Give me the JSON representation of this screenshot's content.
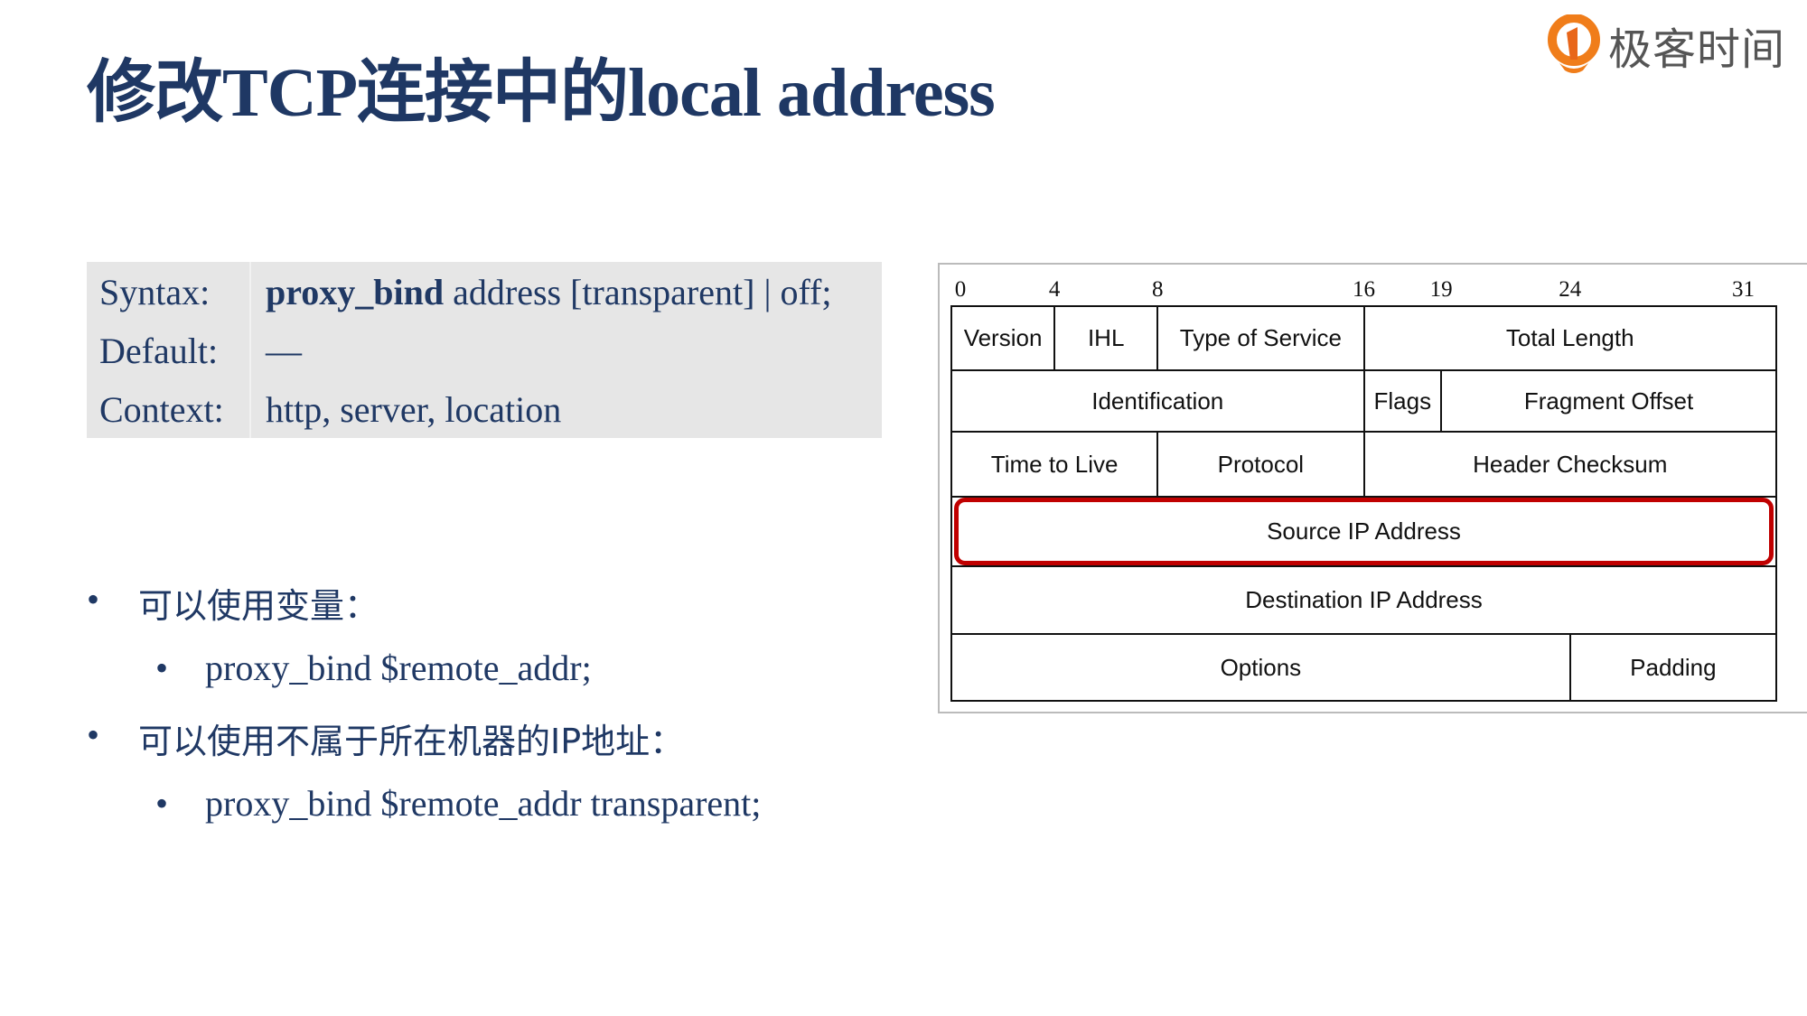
{
  "title": "修改TCP连接中的local address",
  "logo": {
    "text": "极客时间",
    "color": "#f07d1a"
  },
  "syntax_box": {
    "rows": [
      {
        "label": "Syntax:",
        "keyword": "proxy_bind",
        "value": " address [transparent] | off;"
      },
      {
        "label": "Default:",
        "keyword": "",
        "value": "—"
      },
      {
        "label": "Context:",
        "keyword": "",
        "value": "http, server, location"
      }
    ]
  },
  "bullets": [
    {
      "text": "可以使用变量：",
      "sub": "proxy_bind $remote_addr;"
    },
    {
      "text": "可以使用不属于所在机器的IP地址：",
      "sub": "proxy_bind $remote_addr transparent;"
    }
  ],
  "diagram": {
    "bit_labels": [
      "0",
      "4",
      "8",
      "16",
      "19",
      "24",
      "31"
    ],
    "fields": [
      {
        "name": "Version",
        "row": 0,
        "from": 0,
        "to": 4
      },
      {
        "name": "IHL",
        "row": 0,
        "from": 4,
        "to": 8
      },
      {
        "name": "Type of Service",
        "row": 0,
        "from": 8,
        "to": 16
      },
      {
        "name": "Total Length",
        "row": 0,
        "from": 16,
        "to": 32
      },
      {
        "name": "Identification",
        "row": 1,
        "from": 0,
        "to": 16
      },
      {
        "name": "Flags",
        "row": 1,
        "from": 16,
        "to": 19
      },
      {
        "name": "Fragment Offset",
        "row": 1,
        "from": 19,
        "to": 32
      },
      {
        "name": "Time to Live",
        "row": 2,
        "from": 0,
        "to": 8
      },
      {
        "name": "Protocol",
        "row": 2,
        "from": 8,
        "to": 16
      },
      {
        "name": "Header Checksum",
        "row": 2,
        "from": 16,
        "to": 32
      },
      {
        "name": "Source IP Address",
        "row": 3,
        "from": 0,
        "to": 32,
        "highlighted": true
      },
      {
        "name": "Destination IP Address",
        "row": 4,
        "from": 0,
        "to": 32
      },
      {
        "name": "Options",
        "row": 5,
        "from": 0,
        "to": 24
      },
      {
        "name": "Padding",
        "row": 5,
        "from": 24,
        "to": 32
      }
    ],
    "highlight_color": "#c00000"
  }
}
